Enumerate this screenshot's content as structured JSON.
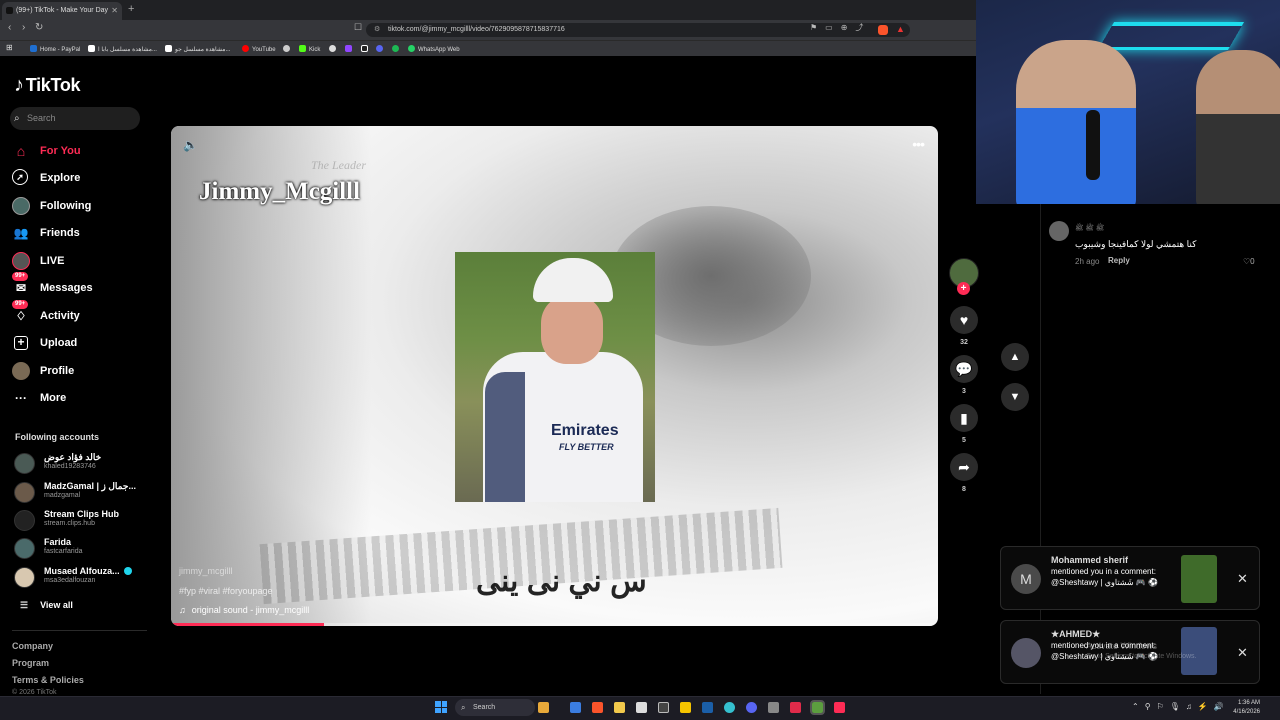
{
  "browser": {
    "tab_title": "(99+) TikTok - Make Your Day",
    "url": "tiktok.com/@jimmy_mcgilll/video/7629095878715837716",
    "bookmarks": [
      {
        "label": "Home - PayPal",
        "color": "#1f6fd1"
      },
      {
        "label": "مشاهدة مسلسل بابا ا...",
        "color": "#ffffff"
      },
      {
        "label": "مشاهدة مسلسل جو...",
        "color": "#ffffff"
      },
      {
        "label": "YouTube",
        "color": "#ff0000"
      },
      {
        "label": "Kick",
        "color": "#53fc18"
      },
      {
        "label": "WhatsApp Web",
        "color": "#25d366"
      }
    ]
  },
  "tiktok": {
    "logo": "TikTok",
    "search_placeholder": "Search",
    "nav": [
      {
        "label": "For You",
        "icon": "home-icon",
        "active": true
      },
      {
        "label": "Explore",
        "icon": "compass-icon"
      },
      {
        "label": "Following",
        "icon": "following-avatar-icon"
      },
      {
        "label": "Friends",
        "icon": "friends-icon"
      },
      {
        "label": "LIVE",
        "icon": "live-icon"
      },
      {
        "label": "Messages",
        "icon": "messages-icon",
        "badge": "99+"
      },
      {
        "label": "Activity",
        "icon": "activity-icon",
        "badge": "99+"
      },
      {
        "label": "Upload",
        "icon": "upload-icon"
      },
      {
        "label": "Profile",
        "icon": "profile-icon"
      },
      {
        "label": "More",
        "icon": "more-dots-icon"
      }
    ],
    "following_header": "Following accounts",
    "accounts": [
      {
        "name": "خالد فؤاد عوض",
        "handle": "khaled19283746"
      },
      {
        "name": "MadzGamal | جمال ز...",
        "handle": "madzgamal"
      },
      {
        "name": "Stream Clips Hub",
        "handle": "stream.clips.hub"
      },
      {
        "name": "Farida",
        "handle": "fastcarfarida"
      },
      {
        "name": "Musaed Alfouza...",
        "handle": "msa3edalfouzan",
        "verified": true
      }
    ],
    "view_all": "View all",
    "footer": [
      "Company",
      "Program",
      "Terms & Policies",
      "© 2026 TikTok"
    ]
  },
  "video": {
    "overlay_title": "Jimmy_Mcgilll",
    "watermark": "The Leader",
    "handle": "jimmy_mcgilll",
    "caption": "#fyp #viral #foryoupage",
    "sound": "original sound - jimmy_mcgilll",
    "photo_sponsor": "Emirates",
    "photo_sponsor_sub": "FLY BETTER",
    "subtitle_arabic": "س ني نى ينى",
    "progress": 0.2
  },
  "actions": {
    "likes": "32",
    "comments": "3",
    "saves": "5",
    "shares": "8"
  },
  "comment": {
    "user": "ﷺ ﷺ ﷺ",
    "text": "كنا هتمشي لولا كمافينجا وشيبوب",
    "time": "2h ago",
    "reply": "Reply",
    "likes": "0"
  },
  "notifications": [
    {
      "name": "Mohammed sherif",
      "initial": "M",
      "text": "mentioned you in a comment: @Sheshtawy | شَشتاوي 🎮 ⚽",
      "thumb": "#3f6b2a"
    },
    {
      "name": "★AHMED★",
      "initial": "",
      "text": "mentioned you in a comment: @Sheshtawy | شَشتاوي 🎮 ⚽",
      "thumb": "#3b4d7a"
    }
  ],
  "windows": {
    "activate_line1": "Activate Windows",
    "activate_line2": "Go to Settings to activate Windows.",
    "search": "Search",
    "time": "1:36 AM",
    "date": "4/16/2026"
  }
}
